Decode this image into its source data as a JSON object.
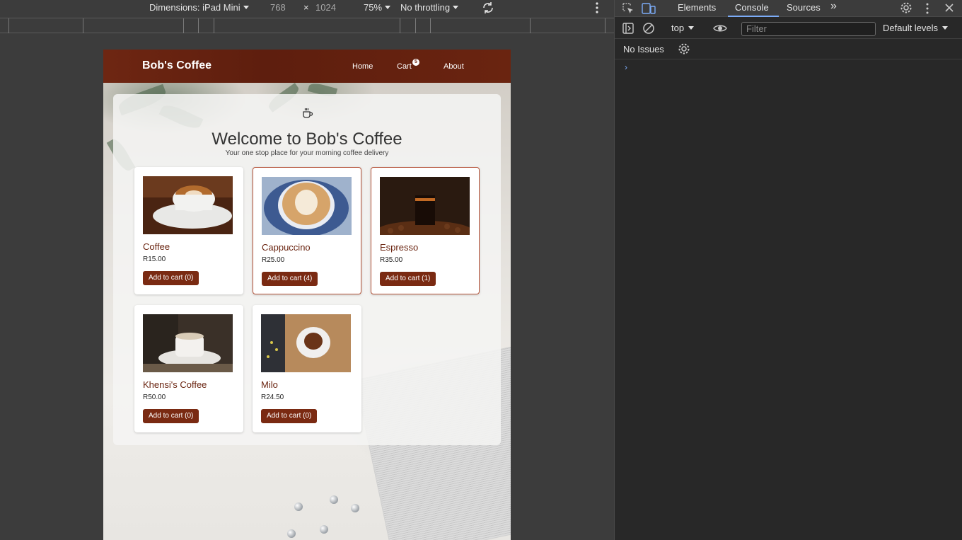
{
  "emulation_toolbar": {
    "device_label": "Dimensions: iPad Mini",
    "width": "768",
    "times": "×",
    "height": "1024",
    "zoom": "75%",
    "throttling": "No throttling",
    "rotate_icon": "rotate-icon",
    "more_icon": "more-vert-icon"
  },
  "site": {
    "brand": "Bob's Coffee",
    "nav": {
      "home": "Home",
      "cart": "Cart",
      "cart_count": "5",
      "about": "About"
    },
    "hero_icon": "coffee-cup-icon",
    "hero_title": "Welcome to Bob's Coffee",
    "hero_subtitle": "Your one stop place for your morning coffee delivery",
    "products": [
      {
        "name": "Coffee",
        "price": "R15.00",
        "button": "Add to cart (0)"
      },
      {
        "name": "Cappuccino",
        "price": "R25.00",
        "button": "Add to cart (4)"
      },
      {
        "name": "Espresso",
        "price": "R35.00",
        "button": "Add to cart (1)"
      },
      {
        "name": "Khensi's Coffee",
        "price": "R50.00",
        "button": "Add to cart (0)"
      },
      {
        "name": "Milo",
        "price": "R24.50",
        "button": "Add to cart (0)"
      }
    ]
  },
  "devtools": {
    "tabs": {
      "elements": "Elements",
      "console": "Console",
      "sources": "Sources",
      "more": "»"
    },
    "context": "top",
    "filter_placeholder": "Filter",
    "levels": "Default levels",
    "issues": "No Issues",
    "prompt": "›",
    "colors": {
      "accent": "#7cacf8",
      "brand": "#6e2612"
    }
  }
}
